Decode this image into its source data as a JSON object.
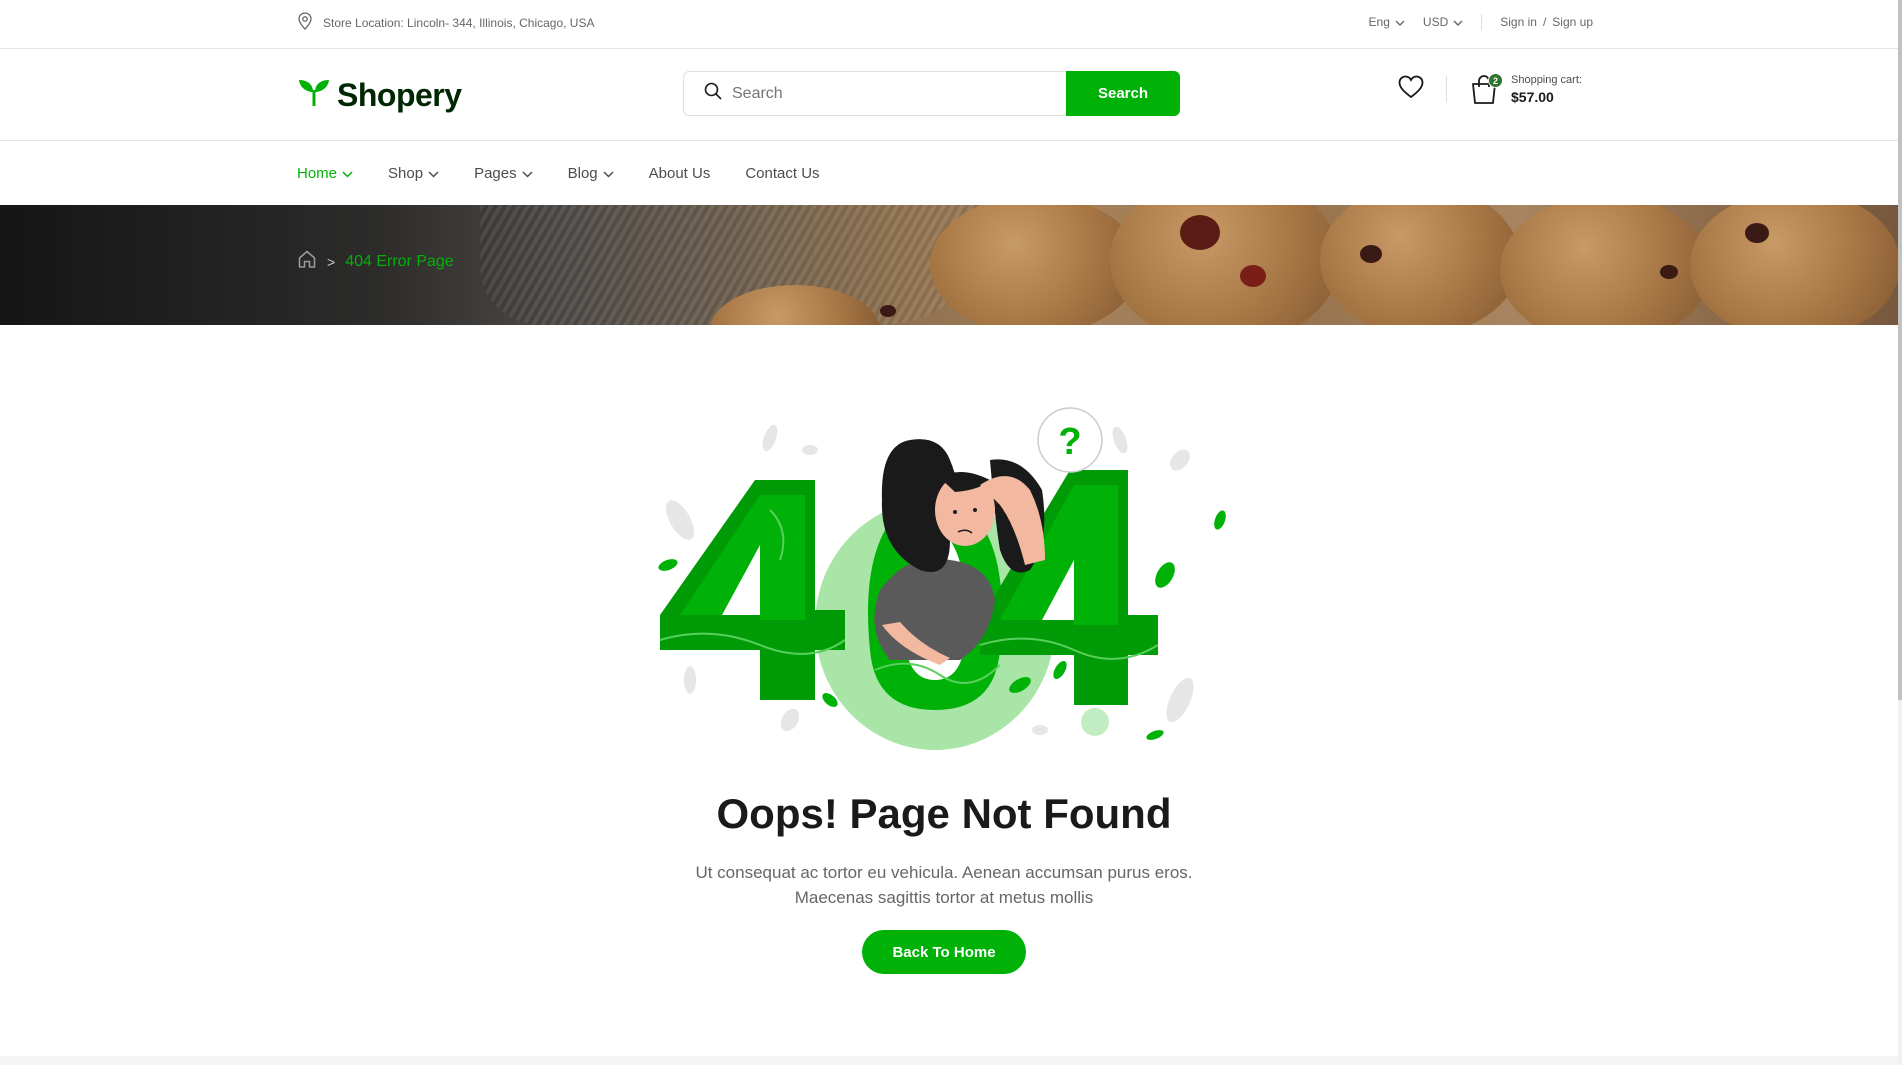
{
  "topbar": {
    "location": "Store Location: Lincoln- 344, Illinois, Chicago, USA",
    "language": "Eng",
    "currency": "USD",
    "sign_in": "Sign in",
    "slash": "/",
    "sign_up": "Sign up"
  },
  "header": {
    "logo_text": "Shopery",
    "search_placeholder": "Search",
    "search_button": "Search",
    "cart_count": "2",
    "cart_label": "Shopping cart:",
    "cart_total": "$57.00"
  },
  "nav": {
    "items": [
      {
        "label": "Home",
        "dropdown": true,
        "active": true
      },
      {
        "label": "Shop",
        "dropdown": true
      },
      {
        "label": "Pages",
        "dropdown": true
      },
      {
        "label": "Blog",
        "dropdown": true
      },
      {
        "label": "About Us"
      },
      {
        "label": "Contact Us"
      }
    ]
  },
  "breadcrumb": {
    "current": "404 Error Page"
  },
  "error": {
    "code": "404",
    "bubble": "?",
    "title": "Oops! Page Not Found",
    "description_line1": "Ut consequat ac tortor eu vehicula. Aenean accumsan purus eros.",
    "description_line2": "Maecenas sagittis tortor at metus mollis",
    "button": "Back To Home"
  },
  "colors": {
    "accent": "#00b207",
    "dark_green": "#2c742f",
    "heading": "#1a1a1a",
    "muted": "#666666"
  },
  "icons": [
    "map-pin-icon",
    "chevron-down-icon",
    "leaf-logo-icon",
    "search-icon",
    "heart-icon",
    "shopping-bag-icon",
    "home-icon"
  ]
}
